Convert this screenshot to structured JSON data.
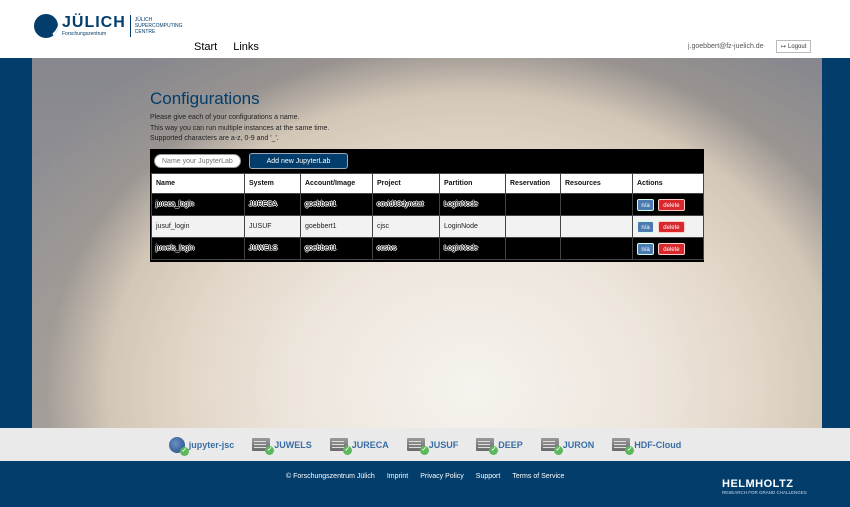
{
  "brand": {
    "name": "JÜLICH",
    "sub": "Forschungszentrum",
    "centre": "JÜLICH SUPERCOMPUTING CENTRE"
  },
  "nav": {
    "start": "Start",
    "links": "Links"
  },
  "user": {
    "email": "j.goebbert@fz-juelich.de",
    "logout": "Logout"
  },
  "page": {
    "title": "Configurations",
    "desc_line1": "Please give each of your configurations a name.",
    "desc_line2": "This way you can run multiple instances at the same time.",
    "desc_line3": "Supported characters are a-z, 0-9 and '_'."
  },
  "toolbar": {
    "name_placeholder": "Name your JupyterLab",
    "add_label": "Add new JupyterLab"
  },
  "table": {
    "headers": [
      "Name",
      "System",
      "Account/Image",
      "Project",
      "Partition",
      "Reservation",
      "Resources",
      "Actions"
    ],
    "rows": [
      {
        "name": "jureca_login",
        "system": "JURECA",
        "account": "goebbert1",
        "project": "covid19dynstat",
        "partition": "LoginNode",
        "reservation": "",
        "resources": "",
        "na": "n/a",
        "del": "delete"
      },
      {
        "name": "jusuf_login",
        "system": "JUSUF",
        "account": "goebbert1",
        "project": "cjsc",
        "partition": "LoginNode",
        "reservation": "",
        "resources": "",
        "na": "n/a",
        "del": "delete"
      },
      {
        "name": "juwels_login",
        "system": "JUWELS",
        "account": "goebbert1",
        "project": "ccstvs",
        "partition": "LoginNode",
        "reservation": "",
        "resources": "",
        "na": "n/a",
        "del": "delete"
      }
    ]
  },
  "systems": [
    "jupyter-jsc",
    "JUWELS",
    "JURECA",
    "JUSUF",
    "DEEP",
    "JURON",
    "HDF-Cloud"
  ],
  "footer": {
    "copyright": "© Forschungszentrum Jülich",
    "imprint": "Imprint",
    "privacy": "Privacy Policy",
    "support": "Support",
    "terms": "Terms of Service"
  },
  "helmholtz": {
    "name": "HELMHOLTZ",
    "tagline": "RESEARCH FOR GRAND CHALLENGES"
  },
  "colors": {
    "brand_blue": "#023d6b",
    "link_blue": "#3a6ea5",
    "delete_red": "#d9272e",
    "na_blue": "#4a7ab0"
  }
}
